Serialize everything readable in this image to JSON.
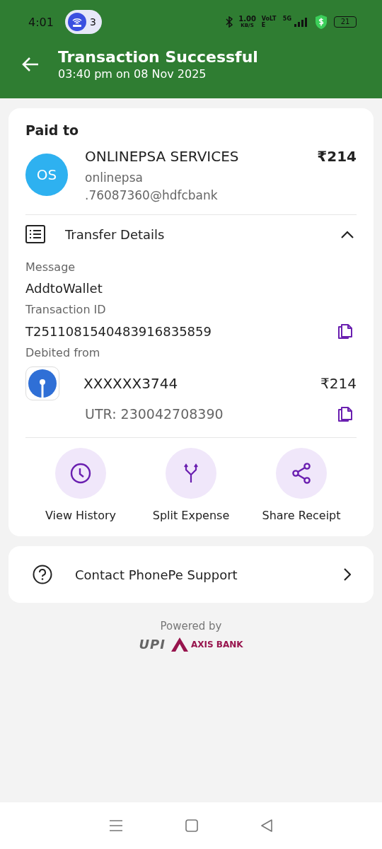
{
  "status_bar": {
    "time": "4:01",
    "hotspot_count": "3",
    "net_speed": "1.00",
    "net_unit": "KB/S",
    "volte": "VoLTE",
    "network": "5G",
    "battery": "21"
  },
  "header": {
    "title": "Transaction Successful",
    "subtitle": "03:40 pm on 08 Nov 2025"
  },
  "paid_to": {
    "heading": "Paid to",
    "initials": "OS",
    "name": "ONLINEPSA SERVICES",
    "upi_id": [
      "onlinepsa",
      ".76087360@hdfcbank"
    ],
    "amount": "₹214"
  },
  "transfer_details": {
    "title": "Transfer Details",
    "expanded": true,
    "fields": [
      {
        "label": "Message",
        "value": "AddtoWallet",
        "copyable": false
      },
      {
        "label": "Transaction ID",
        "value": "T2511081540483916835859",
        "copyable": true
      }
    ],
    "debited": {
      "label": "Debited from",
      "account": "XXXXXX3744",
      "amount": "₹214",
      "utr": "UTR: 230042708390"
    }
  },
  "actions": [
    {
      "kind": "history",
      "label": "View History"
    },
    {
      "kind": "split",
      "label": "Split Expense"
    },
    {
      "kind": "share",
      "label": "Share Receipt"
    }
  ],
  "support": {
    "label": "Contact PhonePe Support"
  },
  "footer": {
    "powered_by": "Powered by",
    "upi_logo": "UPI",
    "bank_logo": "AXIS BANK"
  }
}
